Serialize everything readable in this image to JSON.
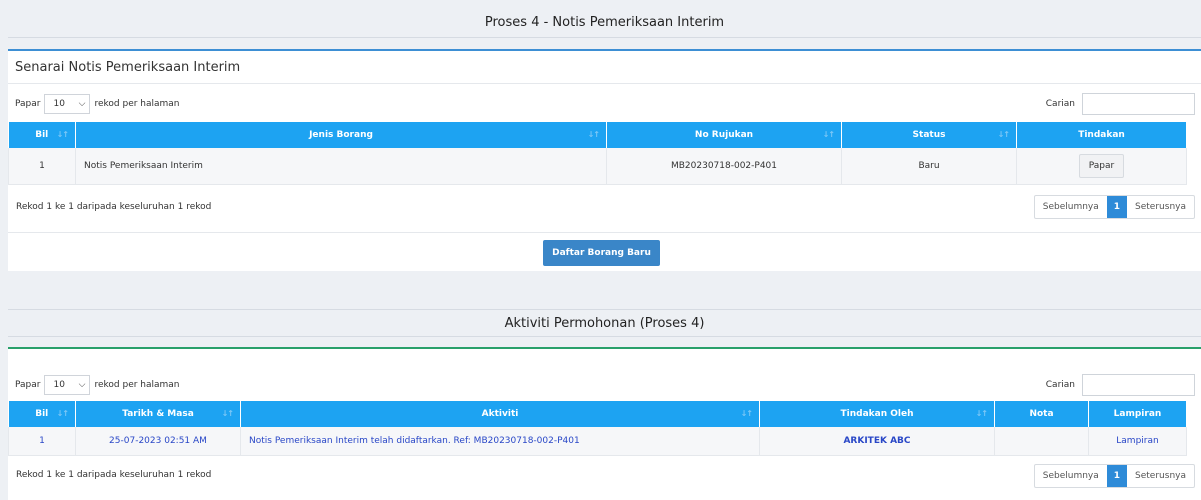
{
  "page_title": "Proses 4 - Notis Pemeriksaan Interim",
  "panel1": {
    "title": "Senarai Notis Pemeriksaan Interim",
    "length_label_before": "Papar",
    "length_value": "10",
    "length_label_after": "rekod per halaman",
    "search_label": "Carian",
    "search_value": "",
    "columns": [
      "Bil",
      "Jenis Borang",
      "No Rujukan",
      "Status",
      "Tindakan"
    ],
    "rows": [
      {
        "bil": "1",
        "jenis_borang": "Notis Pemeriksaan Interim",
        "no_rujukan": "MB20230718-002-P401",
        "status": "Baru",
        "tindakan": "Papar"
      }
    ],
    "info": "Rekod 1 ke 1 daripada keseluruhan 1 rekod",
    "pager": {
      "prev": "Sebelumnya",
      "current": "1",
      "next": "Seterusnya"
    },
    "new_button": "Daftar Borang Baru"
  },
  "section2_title": "Aktiviti Permohonan (Proses 4)",
  "panel2": {
    "length_label_before": "Papar",
    "length_value": "10",
    "length_label_after": "rekod per halaman",
    "search_label": "Carian",
    "search_value": "",
    "columns": [
      "Bil",
      "Tarikh & Masa",
      "Aktiviti",
      "Tindakan Oleh",
      "Nota",
      "Lampiran"
    ],
    "rows": [
      {
        "bil": "1",
        "tarikh": "25-07-2023 02:51 AM",
        "aktiviti": "Notis Pemeriksaan Interim telah didaftarkan. Ref: MB20230718-002-P401",
        "oleh": "ARKITEK ABC",
        "nota": "",
        "lampiran": "Lampiran"
      }
    ],
    "info": "Rekod 1 ke 1 daripada keseluruhan 1 rekod",
    "pager": {
      "prev": "Sebelumnya",
      "current": "1",
      "next": "Seterusnya"
    }
  },
  "colors": {
    "table_header": "#1da3f2",
    "panel1_accent": "#3d8fd4",
    "panel2_accent": "#29a06a",
    "primary_button": "#3a86c8",
    "link": "#2947c7"
  },
  "icons": [
    "sort-icon",
    "chevron-down-icon"
  ]
}
